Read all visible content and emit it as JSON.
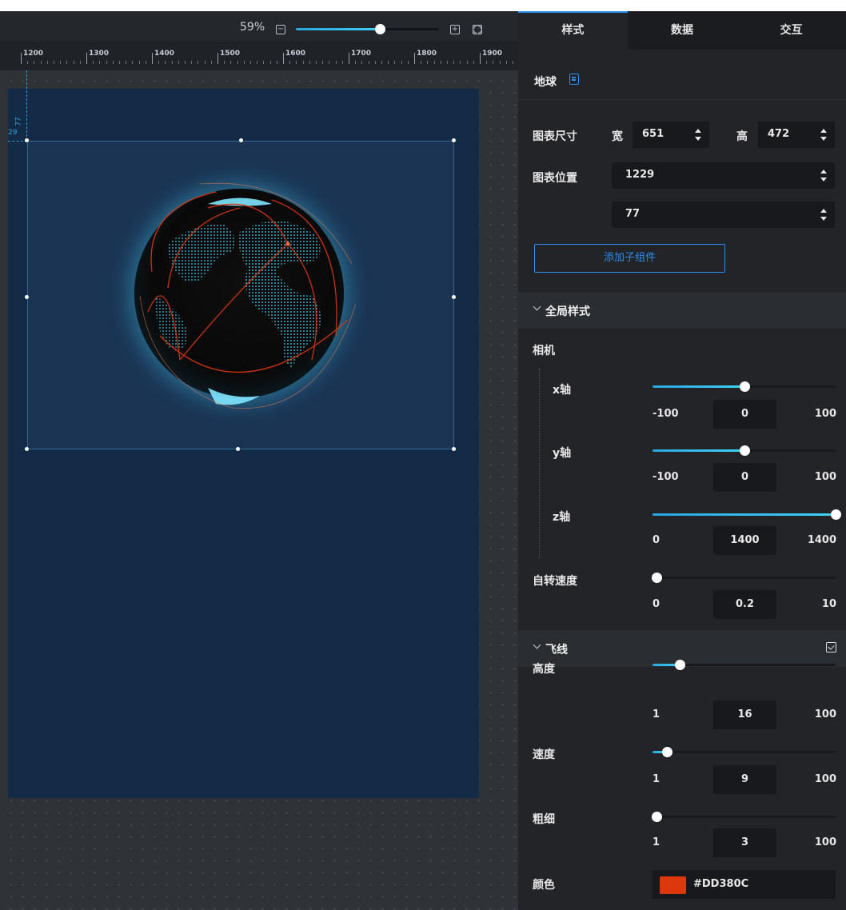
{
  "zoom": {
    "percent": "59%",
    "level": 0.59
  },
  "ruler": {
    "labels": [
      "1200",
      "1300",
      "1400",
      "1500",
      "1600",
      "1700",
      "1800",
      "1900"
    ]
  },
  "guides": {
    "x_label": "77",
    "y_label": "29"
  },
  "tabs": [
    {
      "label": "样式",
      "active": true
    },
    {
      "label": "数据",
      "active": false
    },
    {
      "label": "交互",
      "active": false
    }
  ],
  "component": {
    "title": "地球"
  },
  "size": {
    "label": "图表尺寸",
    "width_label": "宽",
    "width": "651",
    "height_label": "高",
    "height": "472"
  },
  "position": {
    "label": "图表位置",
    "x": "1229",
    "y": "77"
  },
  "add_child_label": "添加子组件",
  "global_section": {
    "title": "全局样式",
    "camera_label": "相机",
    "x_axis": {
      "label": "x轴",
      "min": "-100",
      "max": "100",
      "value": "0",
      "fraction": 0.5
    },
    "y_axis": {
      "label": "y轴",
      "min": "-100",
      "max": "100",
      "value": "0",
      "fraction": 0.5
    },
    "z_axis": {
      "label": "z轴",
      "min": "0",
      "max": "1400",
      "value": "1400",
      "fraction": 1.0
    },
    "rotate_speed": {
      "label": "自转速度",
      "min": "0",
      "max": "10",
      "value": "0.2",
      "fraction": 0.02
    }
  },
  "flyline_section": {
    "title": "飞线",
    "height": {
      "label": "高度",
      "min": "1",
      "max": "100",
      "value": "16",
      "fraction": 0.15
    },
    "speed": {
      "label": "速度",
      "min": "1",
      "max": "100",
      "value": "9",
      "fraction": 0.08
    },
    "thickness": {
      "label": "粗细",
      "min": "1",
      "max": "100",
      "value": "3",
      "fraction": 0.02
    },
    "color": {
      "label": "颜色",
      "value": "#DD380C"
    }
  },
  "colors": {
    "accent": "#2b8ef0",
    "slider": "#3cd2f4",
    "screen_bg": "#142b48"
  }
}
